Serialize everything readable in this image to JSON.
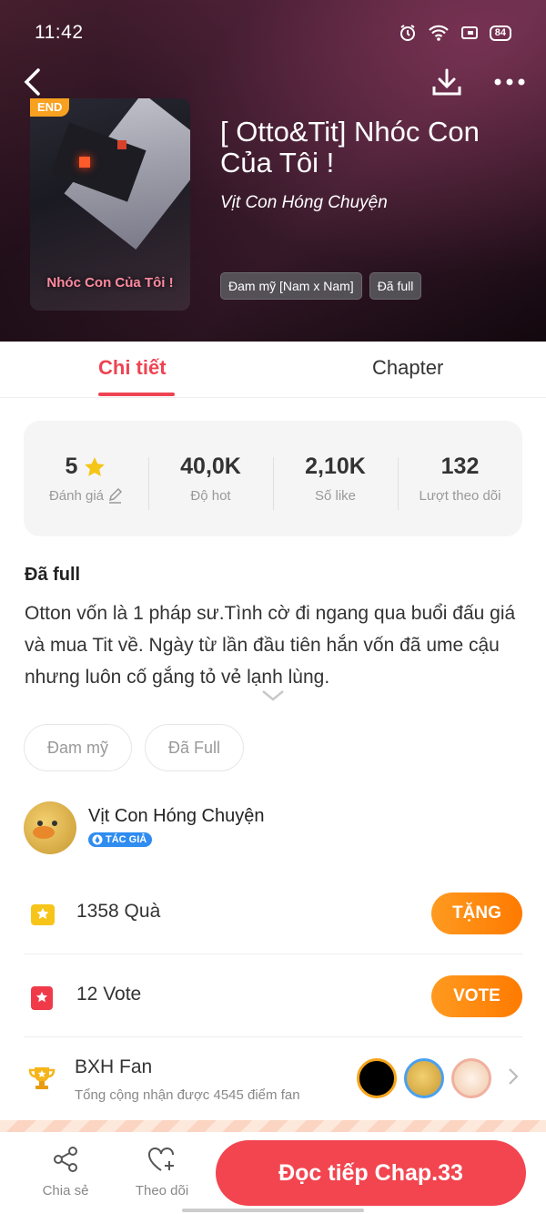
{
  "status_bar": {
    "time": "11:42",
    "battery": "84"
  },
  "book": {
    "badge": "END",
    "cover_title": "Nhóc Con Của Tôi !",
    "title": "[ Otto&Tit] Nhóc Con Của Tôi !",
    "author": "Vịt Con Hóng Chuyện",
    "tags": [
      "Đam mỹ [Nam x Nam]",
      "Đã full"
    ]
  },
  "tabs": {
    "detail": "Chi tiết",
    "chapter": "Chapter"
  },
  "stats": {
    "rating": {
      "value": "5",
      "label": "Đánh giá"
    },
    "hot": {
      "value": "40,0K",
      "label": "Độ hot"
    },
    "likes": {
      "value": "2,10K",
      "label": "Số like"
    },
    "follows": {
      "value": "132",
      "label": "Lượt theo dõi"
    }
  },
  "detail": {
    "status": "Đã full",
    "description": "Otton vốn là 1 pháp sư.Tình cờ đi ngang qua buổi đấu giá và mua Tit về. Ngày từ lần đầu tiên hắn vốn đã ume cậu nhưng luôn cố gắng tỏ vẻ lạnh lùng."
  },
  "genre_chips": [
    "Đam mỹ",
    "Đã Full"
  ],
  "author_block": {
    "name": "Vịt Con Hóng Chuyện",
    "badge": "TÁC GIẢ"
  },
  "gifts": {
    "text": "1358  Quà",
    "button": "TẶNG"
  },
  "votes": {
    "text": "12  Vote",
    "button": "VOTE"
  },
  "fan_rank": {
    "title": "BXH Fan",
    "subtitle": "Tổng cộng nhận được 4545 điểm fan"
  },
  "bottom_bar": {
    "share": "Chia sẻ",
    "follow": "Theo dõi",
    "read": "Đọc tiếp Chap.33"
  },
  "colors": {
    "accent": "#ee4452",
    "orange": "#ff8a10",
    "gold": "#f5c518"
  }
}
